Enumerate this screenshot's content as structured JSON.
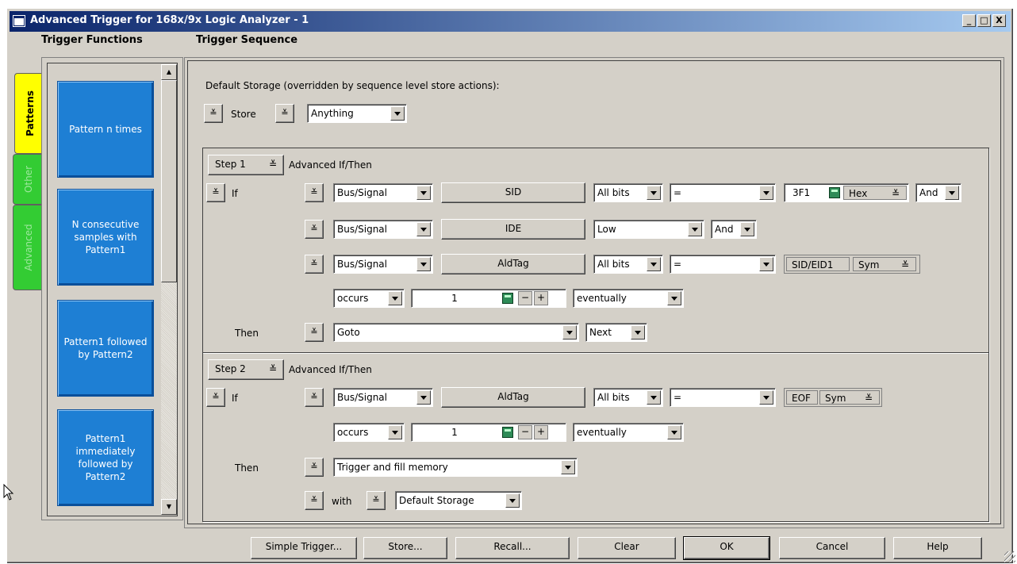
{
  "window": {
    "title": "Advanced Trigger for 168x/9x Logic Analyzer - 1",
    "controls": [
      "_",
      "□",
      "X"
    ]
  },
  "headers": {
    "functions": "Trigger Functions",
    "sequence": "Trigger Sequence"
  },
  "tabs": [
    {
      "label": "Patterns",
      "color": "#ffff00",
      "active": true
    },
    {
      "label": "Other",
      "color": "#33cc33",
      "active": false
    },
    {
      "label": "Advanced",
      "color": "#33cc33",
      "active": false
    }
  ],
  "functions": [
    "Pattern n times",
    "N consecutive samples with Pattern1",
    "Pattern1 followed by Pattern2",
    "Pattern1 immediately followed by Pattern2"
  ],
  "default_storage": {
    "label": "Default Storage (overridden by sequence level store actions):",
    "store_label": "Store",
    "store_value": "Anything"
  },
  "step1": {
    "step_label": "Step 1",
    "mode": "Advanced If/Then",
    "if_label": "If",
    "rows": [
      {
        "type": "Bus/Signal",
        "signal": "SID",
        "bits": "All bits",
        "op": "=",
        "value": "3F1",
        "base": "Hex",
        "conj": "And"
      },
      {
        "type": "Bus/Signal",
        "signal": "IDE",
        "level": "Low",
        "conj": "And"
      },
      {
        "type": "Bus/Signal",
        "signal": "AldTag",
        "bits": "All bits",
        "op": "=",
        "value": "SID/EID1",
        "base": "Sym"
      }
    ],
    "occurs": "occurs",
    "count": "1",
    "minus": "−",
    "plus": "+",
    "when": "eventually",
    "then_label": "Then",
    "action": "Goto",
    "target": "Next"
  },
  "step2": {
    "step_label": "Step 2",
    "mode": "Advanced If/Then",
    "if_label": "If",
    "row": {
      "type": "Bus/Signal",
      "signal": "AldTag",
      "bits": "All bits",
      "op": "=",
      "value": "EOF",
      "base": "Sym"
    },
    "occurs": "occurs",
    "count": "1",
    "minus": "−",
    "plus": "+",
    "when": "eventually",
    "then_label": "Then",
    "action": "Trigger and fill memory",
    "with_label": "with",
    "with_value": "Default Storage"
  },
  "buttons": [
    "Simple Trigger...",
    "Store...",
    "Recall...",
    "Clear",
    "OK",
    "Cancel",
    "Help"
  ],
  "chevron": "≚"
}
